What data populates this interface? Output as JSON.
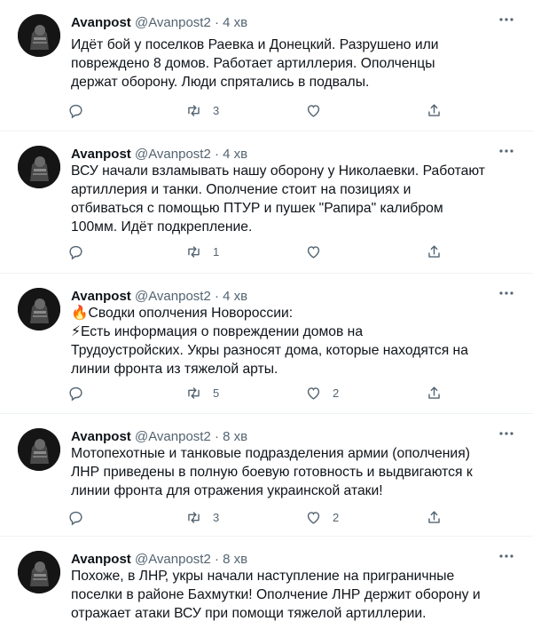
{
  "tweets": [
    {
      "name": "Avanpost",
      "handle": "@Avanpost2",
      "dot": "·",
      "time": "4 хв",
      "text": "Идёт бой у поселков Раевка и Донецкий. Разрушено  или\nповреждено  8 домов. Работает артиллерия. Ополченцы\nдержат оборону. Люди спрятались в подвалы.",
      "replies": "",
      "retweets": "3",
      "likes": ""
    },
    {
      "name": "Avanpost",
      "handle": "@Avanpost2",
      "dot": "·",
      "time": "4 хв",
      "text": "ВСУ начали  взламывать нашу оборону у Николаевки. Работают\nартиллерия и танки. Ополчение стоит на позициях и\nотбиваться с помощью  ПТУР и пушек \"Рапира\" калибром\n100мм. Идёт подкрепление.",
      "replies": "",
      "retweets": "1",
      "likes": ""
    },
    {
      "name": "Avanpost",
      "handle": "@Avanpost2",
      "dot": "·",
      "time": "4 хв",
      "text": "🔥Сводки ополчения Новороссии:\n⚡Есть информация о повреждении домов на\nТрудоустройских. Укры разносят дома, которые находятся на\nлинии фронта из тяжелой арты.",
      "replies": "",
      "retweets": "5",
      "likes": "2"
    },
    {
      "name": "Avanpost",
      "handle": "@Avanpost2",
      "dot": "·",
      "time": "8 хв",
      "text": "Мотопехотные и танковые подразделения армии (ополчения)\nЛНР приведены в полную боевую готовность и выдвигаются к\nлинии фронта для отражения украинской атаки!",
      "replies": "",
      "retweets": "3",
      "likes": "2"
    },
    {
      "name": "Avanpost",
      "handle": "@Avanpost2",
      "dot": "·",
      "time": "8 хв",
      "text": "Похоже, в ЛНР, укры начали наступление на приграничные\nпоселки в районе Бахмутки! Ополчение ЛНР держит оборону и\nотражает атаки ВСУ при помощи тяжелой артиллерии.",
      "replies": "",
      "retweets": "",
      "likes": ""
    }
  ],
  "icons": {
    "more": "more-icon",
    "reply": "reply-icon",
    "retweet": "retweet-icon",
    "like": "heart-icon",
    "share": "share-icon"
  },
  "colors": {
    "text": "#0f1419",
    "secondary": "#536471",
    "divider": "#eff3f4"
  }
}
